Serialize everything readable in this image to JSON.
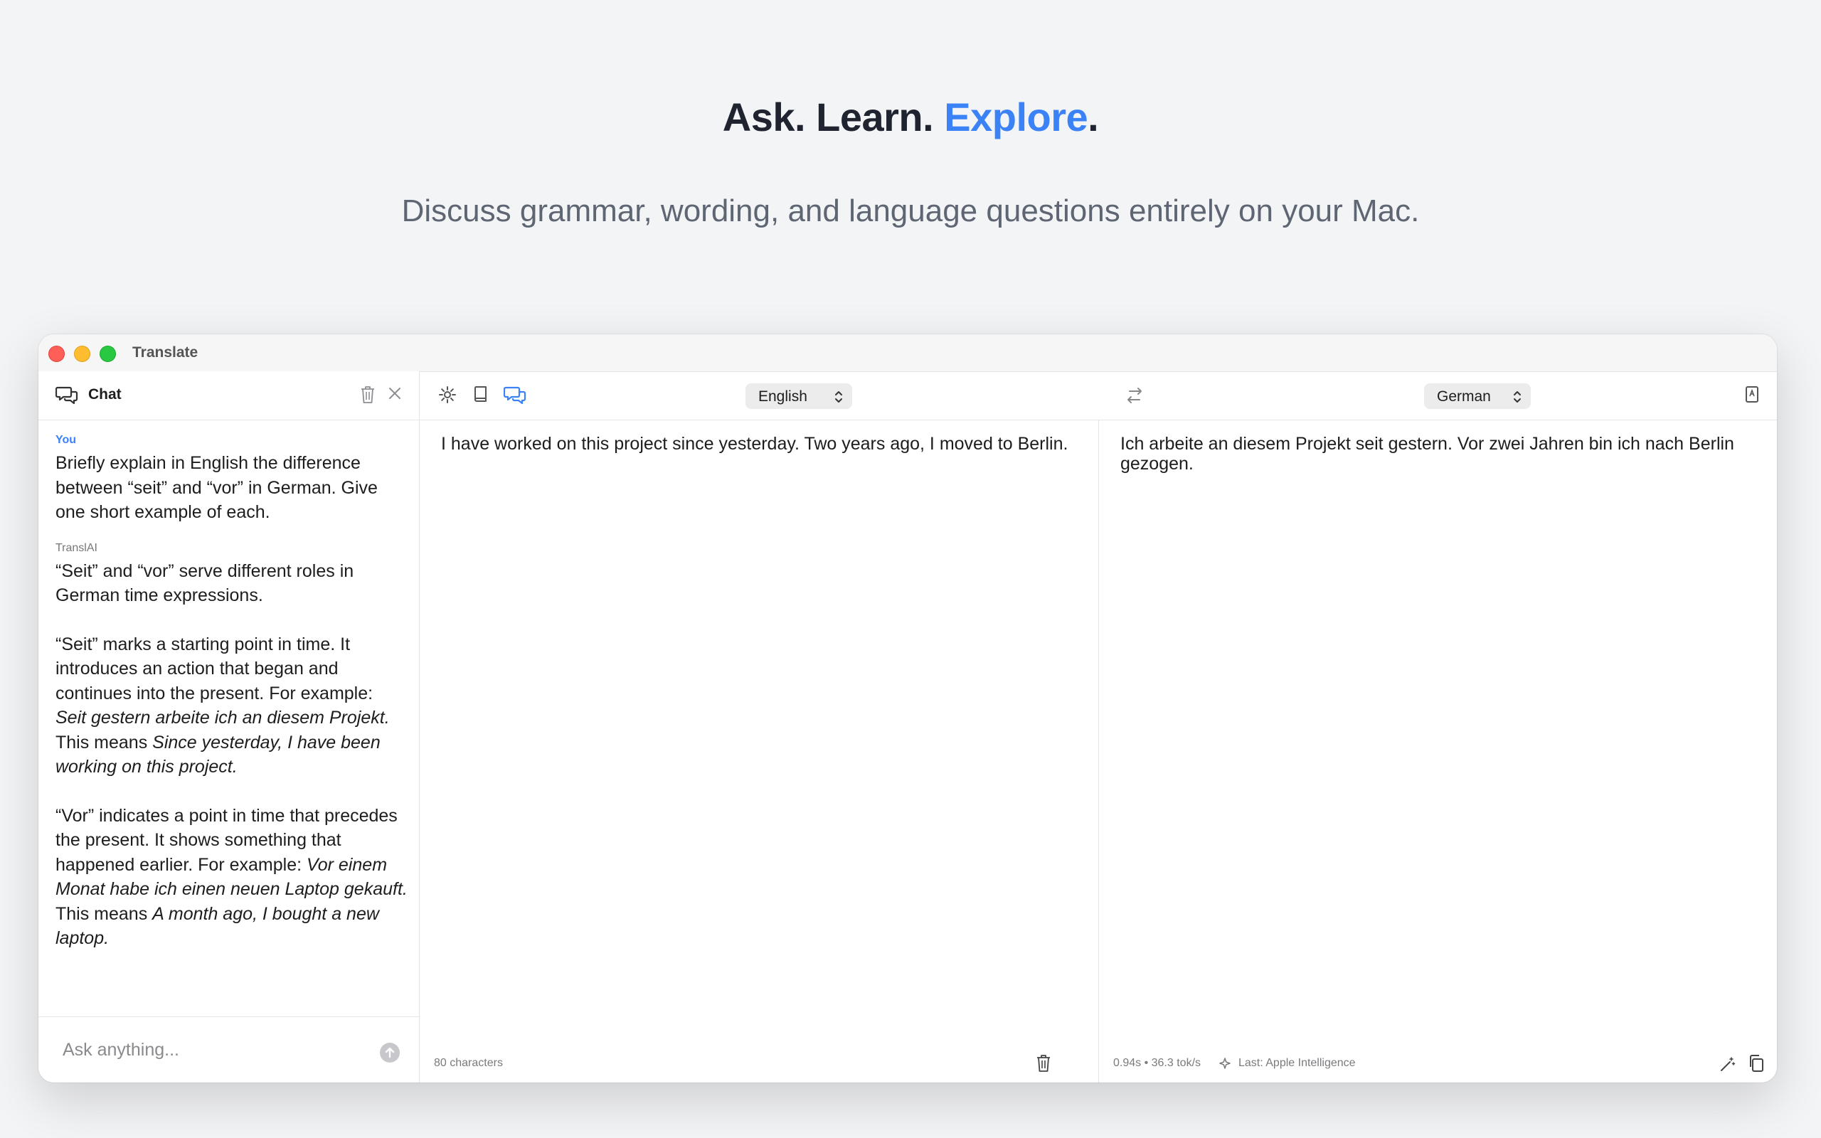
{
  "hero": {
    "title_part1": "Ask. Learn. ",
    "title_accent": "Explore",
    "title_end": ".",
    "subtitle": "Discuss grammar, wording, and language questions entirely on your Mac."
  },
  "window": {
    "title": "Translate"
  },
  "chat": {
    "title": "Chat",
    "user_label": "You",
    "user_message": "Briefly explain in English the difference between “seit” and “vor” in German. Give one short example of each.",
    "ai_label": "TranslAI",
    "ai_p1": "“Seit” and “vor” serve different roles in German time expressions.",
    "ai_p2_a": "“Seit” marks a starting point in time. It introduces an action that began and continues into the present. For example: ",
    "ai_p2_ex": "Seit gestern arbeite ich an diesem Projekt.",
    "ai_p2_b": " This means ",
    "ai_p2_tr": "Since yesterday, I have been working on this project.",
    "ai_p3_a": "“Vor” indicates a point in time that precedes the present. It shows something that happened earlier. For example: ",
    "ai_p3_ex": "Vor einem Monat habe ich einen neuen Laptop gekauft.",
    "ai_p3_b": " This means ",
    "ai_p3_tr": "A month ago, I bought a new laptop.",
    "input_placeholder": "Ask anything..."
  },
  "toolbar": {
    "source_language": "English",
    "target_language": "German",
    "icons": [
      "gear-icon",
      "book-icon",
      "chat-bubbles-icon",
      "swap-icon",
      "dictionary-icon",
      "help-icon"
    ]
  },
  "source": {
    "text": "I have worked on this project since yesterday. Two years ago, I moved to Berlin.",
    "char_count": "80 characters"
  },
  "target": {
    "text": "Ich arbeite an diesem Projekt seit gestern. Vor zwei Jahren bin ich nach Berlin gezogen.",
    "stats": "0.94s • 36.3 tok/s",
    "engine": "Last: Apple Intelligence"
  },
  "colors": {
    "accent": "#3b82f6",
    "background": "#f3f4f6"
  }
}
